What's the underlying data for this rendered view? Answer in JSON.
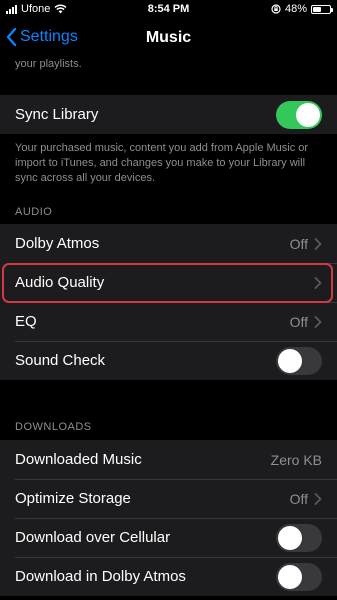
{
  "status_bar": {
    "carrier": "Ufone",
    "time": "8:54 PM",
    "battery": "48%",
    "battery_level": 0.48
  },
  "nav": {
    "back_label": "Settings",
    "title": "Music"
  },
  "partial_footnote": "your playlists.",
  "sync": {
    "label": "Sync Library",
    "on": true,
    "footnote": "Your purchased music, content you add from Apple Music or import to iTunes, and changes you make to your Library will sync across all your devices."
  },
  "audio": {
    "header": "AUDIO",
    "dolby_label": "Dolby Atmos",
    "dolby_value": "Off",
    "quality_label": "Audio Quality",
    "eq_label": "EQ",
    "eq_value": "Off",
    "sound_check_label": "Sound Check",
    "sound_check_on": false
  },
  "downloads": {
    "header": "DOWNLOADS",
    "downloaded_label": "Downloaded Music",
    "downloaded_value": "Zero KB",
    "optimize_label": "Optimize Storage",
    "optimize_value": "Off",
    "cellular_label": "Download over Cellular",
    "cellular_on": false,
    "dolby_dl_label": "Download in Dolby Atmos",
    "dolby_dl_on": false
  },
  "colors": {
    "accent": "#0a84ff",
    "toggle_on": "#34c759",
    "highlight": "#d23a43"
  }
}
